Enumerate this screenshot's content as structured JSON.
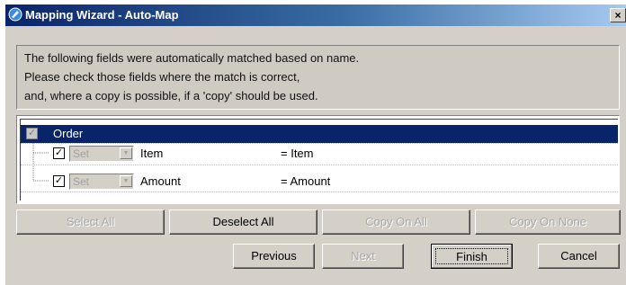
{
  "window": {
    "title": "Mapping Wizard - Auto-Map",
    "close_label": "×"
  },
  "info": {
    "lines": [
      "The following fields were automatically matched based on name.",
      "Please check those fields where the match is correct,",
      "and, where a copy is possible, if a 'copy' should be used."
    ]
  },
  "tree": {
    "root": {
      "label": "Order",
      "checked": true
    },
    "rows": [
      {
        "checked": true,
        "mode": "Set",
        "field": "Item",
        "match": "= Item"
      },
      {
        "checked": true,
        "mode": "Set",
        "field": "Amount",
        "match": "= Amount"
      }
    ],
    "check_mark": "✓"
  },
  "buttons": {
    "select_all": "Select All",
    "deselect_all": "Deselect All",
    "copy_on_all": "Copy On All",
    "copy_on_none": "Copy On None",
    "previous": "Previous",
    "next": "Next",
    "finish": "Finish",
    "cancel": "Cancel"
  },
  "colors": {
    "title_bar_start": "#0a246a",
    "title_bar_end": "#a6caf0",
    "selection": "#0a246a",
    "window_bg": "#d4d0c8"
  }
}
